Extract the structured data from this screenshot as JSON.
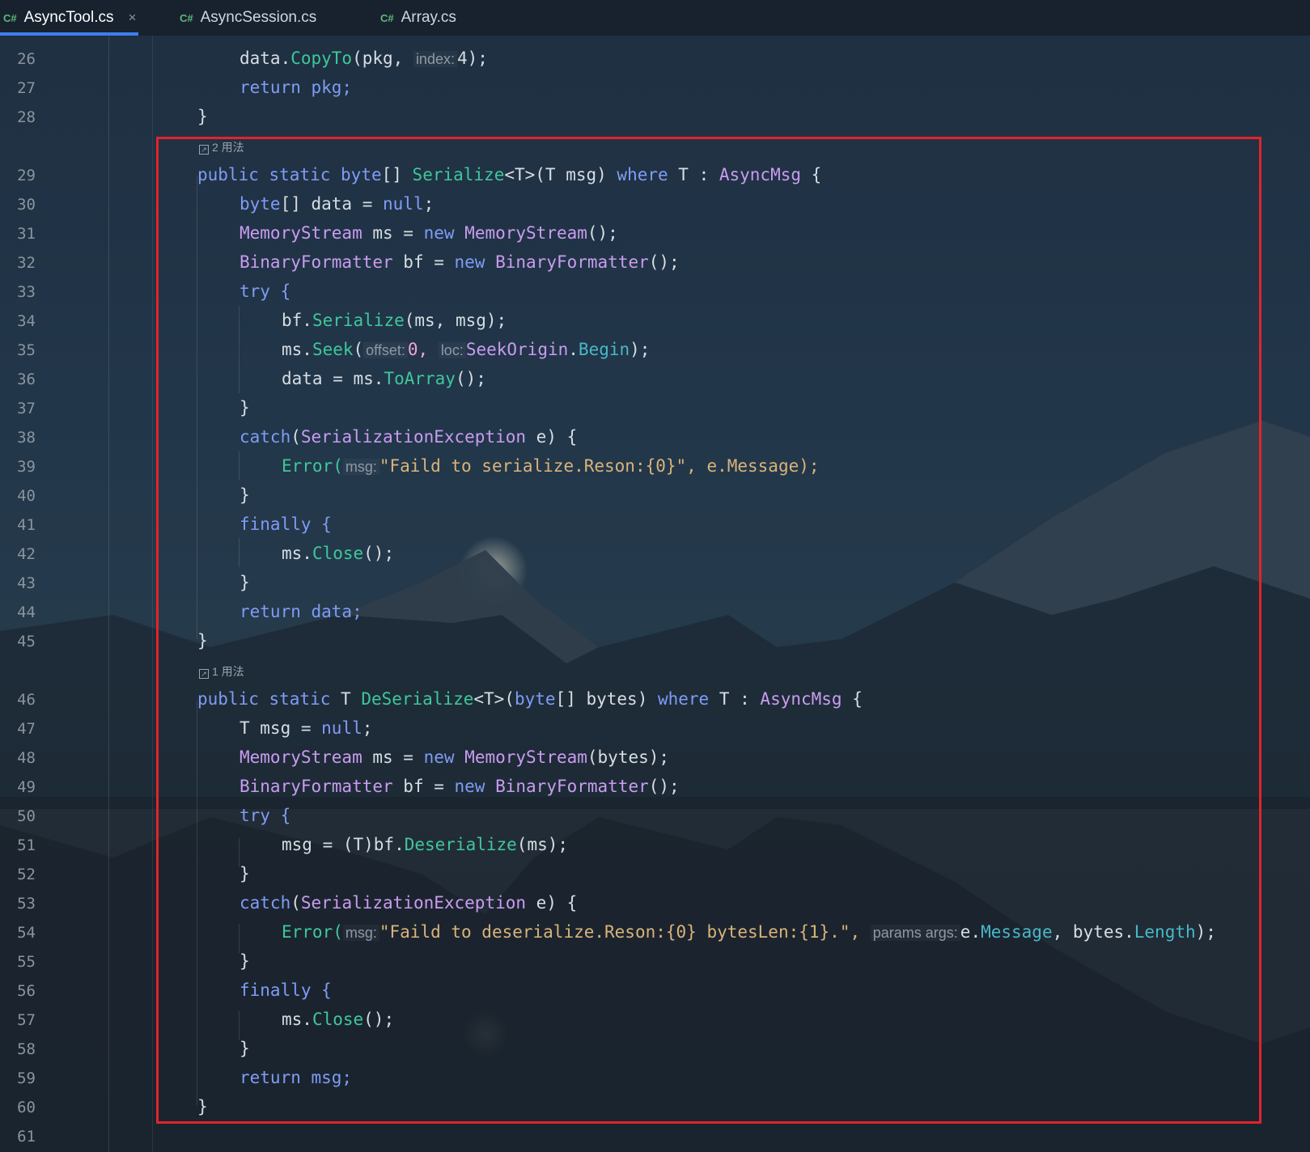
{
  "tabs": [
    {
      "lang": "C#",
      "label": "AsyncTool.cs",
      "active": true,
      "close": "×"
    },
    {
      "lang": "C#",
      "label": "AsyncSession.cs",
      "active": false
    },
    {
      "lang": "C#",
      "label": "Array.cs",
      "active": false
    }
  ],
  "usage_hints": [
    "2 用法",
    "1 用法"
  ],
  "line_numbers": [
    "26",
    "27",
    "28",
    "29",
    "30",
    "31",
    "32",
    "33",
    "34",
    "35",
    "36",
    "37",
    "38",
    "39",
    "40",
    "41",
    "42",
    "43",
    "44",
    "45",
    "46",
    "47",
    "48",
    "49",
    "50",
    "51",
    "52",
    "53",
    "54",
    "55",
    "56",
    "57",
    "58",
    "59",
    "60",
    "61"
  ],
  "parameter_hints": {
    "index": "index:",
    "offset": "offset:",
    "loc": "loc:",
    "msg": "msg:",
    "params_args": "params args:"
  },
  "code": {
    "l26": "data.CopyTo(pkg, ",
    "l26_end": "4);",
    "l27": "return pkg;",
    "l28": "}",
    "l29": "public static byte[] Serialize<T>(T msg) where T : AsyncMsg {",
    "l30": "byte[] data = null;",
    "l31": "MemoryStream ms = new MemoryStream();",
    "l32": "BinaryFormatter bf = new BinaryFormatter();",
    "l33": "try {",
    "l34": "bf.Serialize(ms, msg);",
    "l35a": "ms.Seek(",
    "l35b": "0, ",
    "l35c": "SeekOrigin.Begin);",
    "l36": "data = ms.ToArray();",
    "l37": "}",
    "l38": "catch(SerializationException e) {",
    "l39a": "Error(",
    "l39b": "\"Faild to serialize.Reson:{0}\", e.Message);",
    "l40": "}",
    "l41": "finally {",
    "l42": "ms.Close();",
    "l43": "}",
    "l44": "return data;",
    "l45": "}",
    "l46": "public static T DeSerialize<T>(byte[] bytes) where T : AsyncMsg {",
    "l47": "T msg = null;",
    "l48": "MemoryStream ms = new MemoryStream(bytes);",
    "l49": "BinaryFormatter bf = new BinaryFormatter();",
    "l50": "try {",
    "l51": "msg = (T)bf.Deserialize(ms);",
    "l52": "}",
    "l53": "catch(SerializationException e) {",
    "l54a": "Error(",
    "l54b": "\"Faild to deserialize.Reson:{0} bytesLen:{1}.\", ",
    "l54c": "e.Message, bytes.Length);",
    "l55": "}",
    "l56": "finally {",
    "l57": "ms.Close();",
    "l58": "}",
    "l59": "return msg;",
    "l60": "}"
  },
  "colors": {
    "highlight_border": "#e1242a",
    "tab_underline": "#3d7ff2",
    "keyword": "#7f9cf5",
    "type": "#c99cf0",
    "method": "#3fc79b",
    "member": "#48b8c8",
    "string": "#d9b37a",
    "number": "#f0a4d8"
  }
}
